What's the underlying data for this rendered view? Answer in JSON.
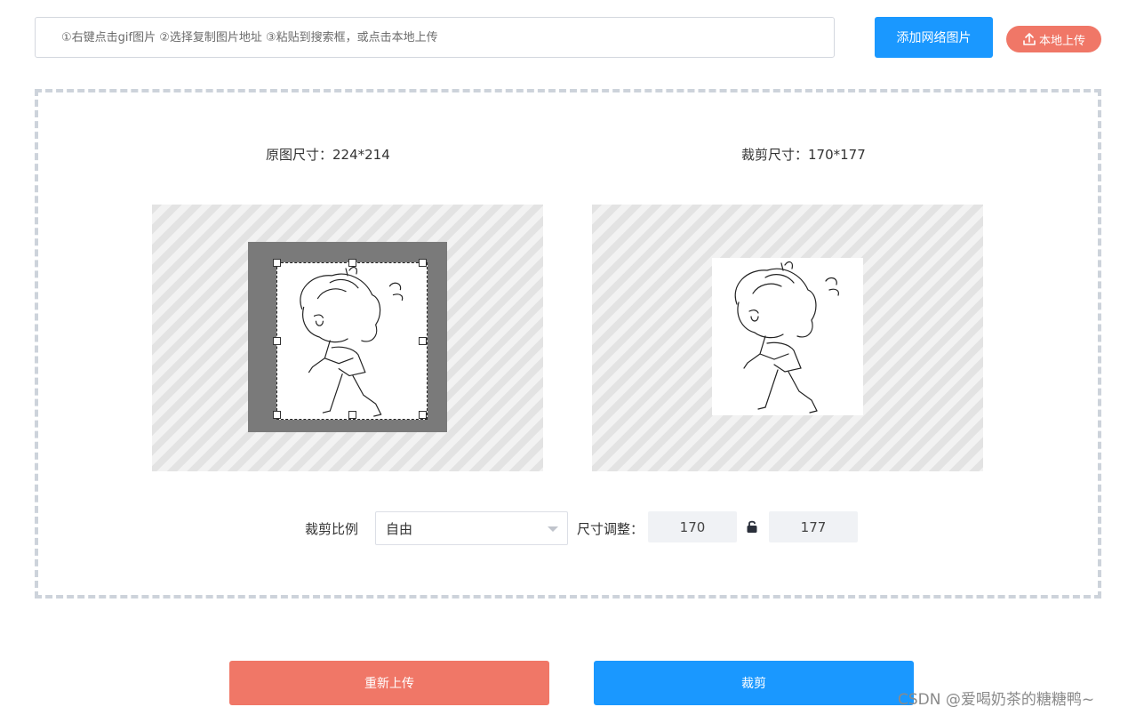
{
  "toolbar": {
    "url_placeholder": "①右键点击gif图片 ②选择复制图片地址 ③粘贴到搜索框，或点击本地上传",
    "add_network_label": "添加网络图片",
    "local_upload_label": "本地上传",
    "upload_icon": "upload-icon"
  },
  "editor": {
    "original_size_label": "原图尺寸：224*214",
    "crop_size_label": "裁剪尺寸：170*177"
  },
  "controls": {
    "ratio_label": "裁剪比例",
    "ratio_selected": "自由",
    "resize_label": "尺寸调整：",
    "width_value": "170",
    "height_value": "177",
    "lock_icon": "lock-open-icon"
  },
  "actions": {
    "reupload_label": "重新上传",
    "crop_label": "裁剪"
  },
  "watermark": "CSDN @爱喝奶茶的糖糖鸭~",
  "colors": {
    "primary": "#1a98ff",
    "danger": "#f07767"
  }
}
